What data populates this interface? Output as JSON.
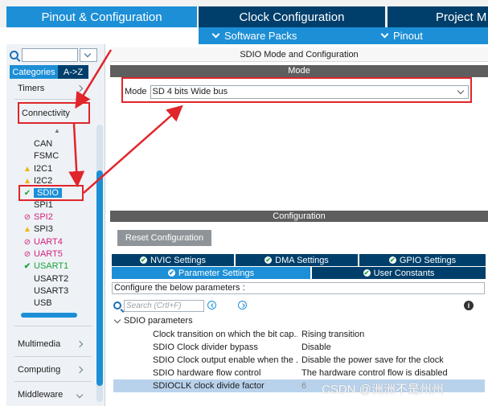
{
  "top_tabs": [
    {
      "label": "Pinout & Configuration",
      "active": true
    },
    {
      "label": "Clock Configuration",
      "active": false
    },
    {
      "label": "Project M",
      "active": false
    }
  ],
  "sub_menu": [
    {
      "label": "Software Packs"
    },
    {
      "label": "Pinout"
    }
  ],
  "left_panel": {
    "category_tabs": [
      {
        "label": "Categories"
      },
      {
        "label": "A->Z"
      }
    ],
    "sections": [
      {
        "label": "Timers"
      },
      {
        "label": "Connectivity"
      }
    ],
    "peripherals": [
      {
        "label": "CAN",
        "status": "none"
      },
      {
        "label": "FSMC",
        "status": "none"
      },
      {
        "label": "I2C1",
        "status": "warning"
      },
      {
        "label": "I2C2",
        "status": "warning"
      },
      {
        "label": "SDIO",
        "status": "selected"
      },
      {
        "label": "SPI1",
        "status": "none"
      },
      {
        "label": "SPI2",
        "status": "forbidden"
      },
      {
        "label": "SPI3",
        "status": "warning"
      },
      {
        "label": "UART4",
        "status": "forbidden"
      },
      {
        "label": "UART5",
        "status": "forbidden"
      },
      {
        "label": "USART1",
        "status": "enabled"
      },
      {
        "label": "USART2",
        "status": "none"
      },
      {
        "label": "USART3",
        "status": "none"
      },
      {
        "label": "USB",
        "status": "none"
      }
    ],
    "bottom_sections": [
      {
        "label": "Multimedia"
      },
      {
        "label": "Computing"
      },
      {
        "label": "Middleware"
      }
    ]
  },
  "mode_panel": {
    "title": "SDIO Mode and Configuration",
    "mode_header": "Mode",
    "mode_label": "Mode",
    "mode_value": "SD 4 bits Wide bus"
  },
  "configuration": {
    "header": "Configuration",
    "reset_button": "Reset Configuration",
    "tabs_row1": [
      {
        "label": "NVIC Settings"
      },
      {
        "label": "DMA Settings"
      },
      {
        "label": "GPIO Settings"
      }
    ],
    "tabs_row2": [
      {
        "label": "Parameter Settings",
        "active": true
      },
      {
        "label": "User Constants",
        "active": false
      }
    ],
    "configure_text": "Configure the below parameters :",
    "search_placeholder": "Search (Crtl+F)",
    "group_label": "SDIO parameters",
    "parameters": [
      {
        "name": "Clock transition on which the bit cap...",
        "value": "Rising transition"
      },
      {
        "name": "SDIO Clock divider bypass",
        "value": "Disable"
      },
      {
        "name": "SDIO Clock output enable when the ...",
        "value": "Disable the power save for the clock"
      },
      {
        "name": "SDIO hardware flow control",
        "value": "The hardware control flow is disabled"
      },
      {
        "name": "SDIOCLK clock divide factor",
        "value": "6"
      }
    ]
  },
  "watermark": "CSDN @洲洲不是州州",
  "colors": {
    "accent_blue": "#1c8fd6",
    "dark_navy": "#003f6b",
    "annotation_red": "#e0252b"
  }
}
